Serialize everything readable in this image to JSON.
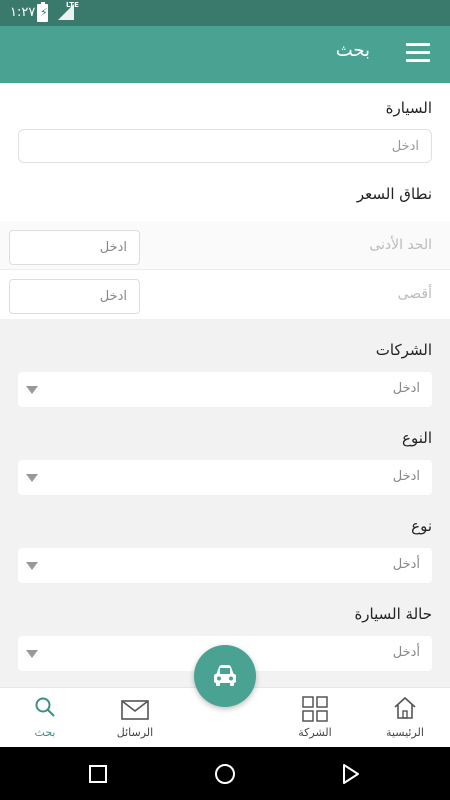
{
  "status_bar": {
    "time": "١:٢٧",
    "network": "LTE"
  },
  "app_bar": {
    "title": "بحث"
  },
  "form": {
    "car": {
      "label": "السيارة",
      "placeholder": "ادخل"
    },
    "price_range": {
      "label": "نطاق السعر",
      "min_label": "الحد الأدنى",
      "min_placeholder": "ادخل",
      "max_label": "أقصى",
      "max_placeholder": "ادخل"
    },
    "companies": {
      "label": "الشركات",
      "value": "ادخل"
    },
    "type": {
      "label": "النوع",
      "value": "ادخل"
    },
    "kind": {
      "label": "نوع",
      "value": "أدخل"
    },
    "car_status": {
      "label": "حالة السيارة",
      "value": "أدخل"
    }
  },
  "bottom_nav": {
    "home": "الرئيسية",
    "company": "الشركة",
    "messages": "الرسائل",
    "search": "بحث"
  },
  "colors": {
    "primary": "#4aa392",
    "status_bar": "#3a7a6c",
    "active": "#3d8f80"
  }
}
